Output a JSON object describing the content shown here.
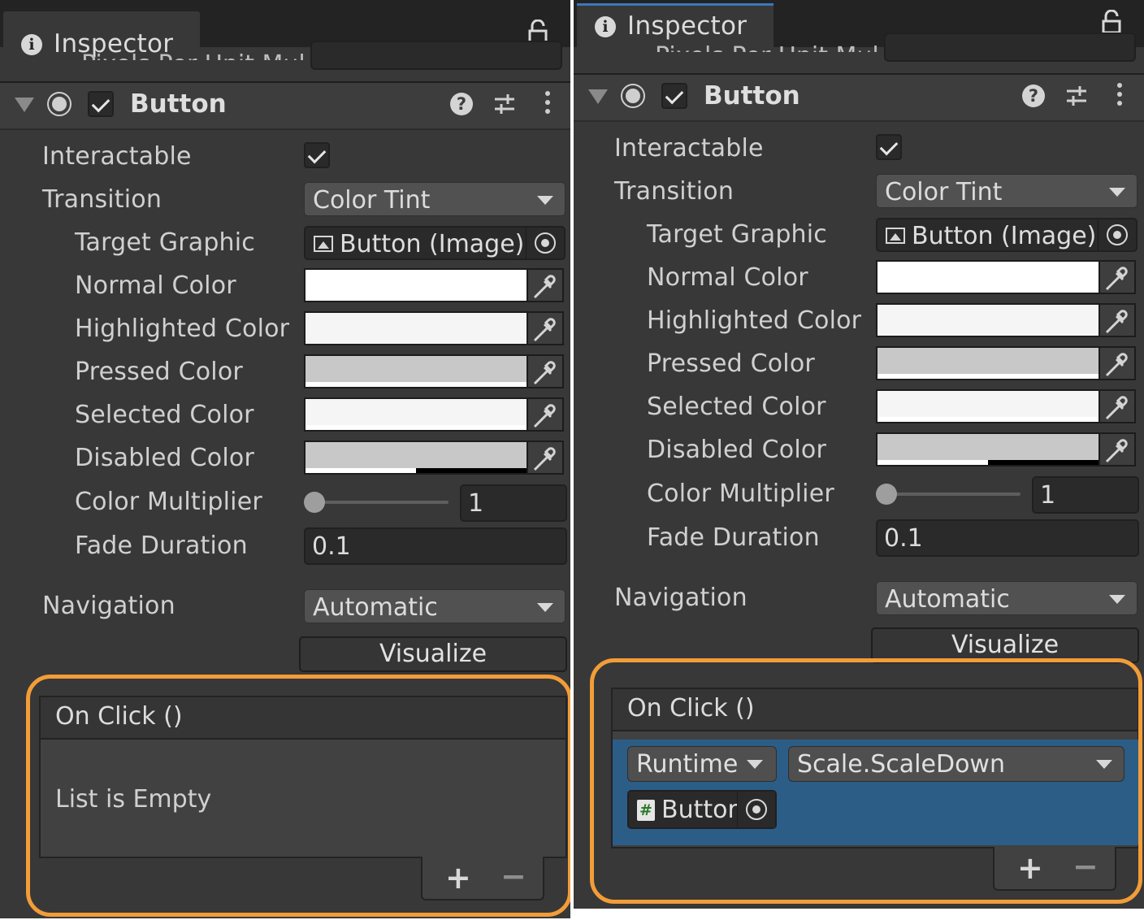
{
  "inspector_tab": {
    "label": "Inspector",
    "cutoff_text": "Pixels Per Unit Mul"
  },
  "component": {
    "title": "Button",
    "enabled": true
  },
  "fields": {
    "interactable": {
      "label": "Interactable",
      "checked": true
    },
    "transition": {
      "label": "Transition",
      "value": "Color Tint"
    },
    "target_graphic": {
      "label": "Target Graphic",
      "value": "Button (Image)"
    },
    "normal_color": {
      "label": "Normal Color",
      "color": "#ffffff"
    },
    "highlighted_color": {
      "label": "Highlighted Color",
      "color": "#f5f5f5"
    },
    "pressed_color": {
      "label": "Pressed Color",
      "color": "#c8c8c8"
    },
    "selected_color": {
      "label": "Selected Color",
      "color": "#f5f5f5"
    },
    "disabled_color": {
      "label": "Disabled Color",
      "color": "#c8c8c8",
      "alpha": 0.5
    },
    "color_multiplier": {
      "label": "Color Multiplier",
      "value": "1"
    },
    "fade_duration": {
      "label": "Fade Duration",
      "value": "0.1"
    },
    "navigation": {
      "label": "Navigation",
      "value": "Automatic"
    },
    "visualize": {
      "label": "Visualize"
    }
  },
  "on_click": {
    "header": "On Click ()"
  },
  "left_panel": {
    "empty_text": "List is Empty"
  },
  "right_panel": {
    "runtime_value": "Runtime",
    "function_value": "Scale.ScaleDown",
    "object_value": "Buttor"
  },
  "list_controls": {
    "plus": "+",
    "minus": "−"
  },
  "colors": {
    "panel_bg": "#383838",
    "highlight": "#f29d38",
    "selection": "#2c5d87"
  },
  "icons": [
    "info-icon",
    "lock-icon",
    "foldout-arrow-icon",
    "component-icon",
    "help-icon",
    "presets-icon",
    "more-icon",
    "image-icon",
    "object-picker-icon",
    "eyedropper-icon",
    "dropdown-arrow-icon",
    "script-icon"
  ]
}
